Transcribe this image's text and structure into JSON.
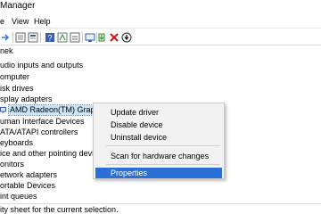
{
  "window": {
    "title": "Manager"
  },
  "menubar": {
    "items": [
      "File",
      "View",
      "Help"
    ],
    "visible": [
      "e",
      "View",
      "Help"
    ]
  },
  "toolbar": {
    "icons": [
      "back-icon",
      "forward-icon",
      "properties-icon",
      "device-list-icon",
      "help-icon",
      "show-hidden-icon",
      "scan-hardware-icon",
      "update-driver-icon",
      "uninstall-icon",
      "disable-icon"
    ],
    "colors": {
      "disable": "#cc1111",
      "update": "#2e8b2e",
      "help": "#3a5fb0"
    }
  },
  "tree": {
    "rows": [
      "nek",
      "udio inputs and outputs",
      "omputer",
      "isk drives",
      "splay adapters",
      "AMD Radeon(TM) Graphics",
      "uman Interface Devices",
      " ATA/ATAPI controllers",
      "eyboards",
      "ice and other pointing devices",
      "onitors",
      "etwork adapters",
      "ortable Devices",
      "int queues"
    ],
    "selected_index": 5,
    "selection_color": "#cce4f7"
  },
  "context_menu": {
    "items": [
      "Update driver",
      "Disable device",
      "Uninstall device",
      "Scan for hardware changes",
      "Properties"
    ],
    "highlighted": "Properties",
    "highlight_color": "#2a6fd6"
  },
  "statusbar": {
    "text": "ity sheet for the current selection."
  }
}
